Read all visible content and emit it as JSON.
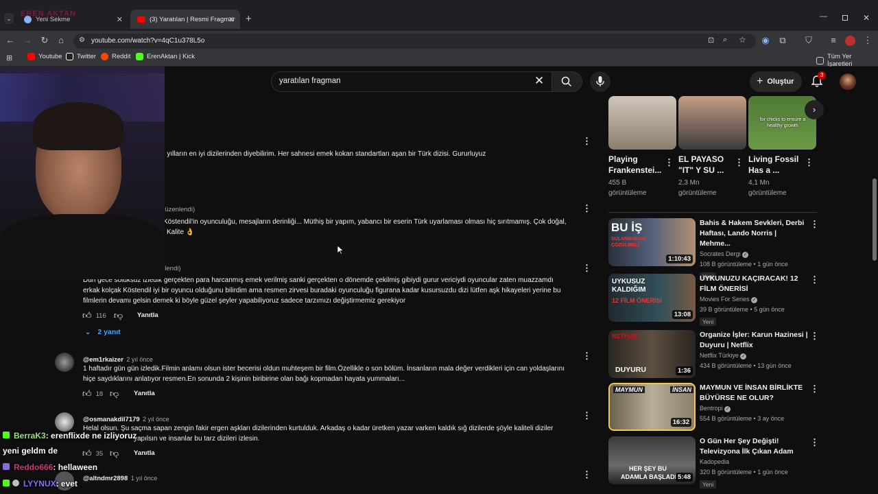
{
  "browser": {
    "tabs": [
      {
        "title": "Yeni Sekme",
        "active": false
      },
      {
        "title": "(3) Yaratılan | Resmi Fragman | N",
        "active": true
      }
    ],
    "url": "youtube.com/watch?v=4qC1u378L5o",
    "bookmarks": [
      {
        "label": "Youtube",
        "color": "#ff0000"
      },
      {
        "label": "Twitter",
        "color": "#ffffff"
      },
      {
        "label": "Reddit",
        "color": "#ff4500"
      },
      {
        "label": "ErenAktan | Kick",
        "color": "#53fc18"
      }
    ],
    "all_bookmarks_label": "Tüm Yer İşaretleri",
    "stream_tag": "EREN AKTAN"
  },
  "youtube": {
    "search_query": "yaratılan fragman",
    "create_label": "Oluştur",
    "notification_count": "3",
    "comments": [
      {
        "text": "n yılların en iyi dizilerinden diyebilirim. Her sahnesi emek kokan standartları aşan bir Türk dizisi. Gururluyuz"
      },
      {
        "meta": "düzenlendi)",
        "text_line1": "Köstendil'in oyunculuğu, mesajların derinliği... Müthiş bir yapım, yabancı bir eserin Türk uyarlaması olması hiç sırıtmamış. Çok doğal,",
        "text_line2": "Kalite 👌"
      },
      {
        "meta": "nlendi)",
        "text_line1": "Dün gece soluksuz izledik gerçekten para harcanmış emek verilmiş sanki gerçekten o dönemde çekilmiş gibiydi gurur vericiydi oyuncular zaten muazzamdı",
        "text_line2": "erkak kolçak Köstendil iyi bir oyuncu olduğunu bilirdim ama resmen zirvesi buradaki oyunculuğu figurana kadar kusursuzdu dizi lütfen aşk hikayeleri yerine bu",
        "text_line3": "filmlerin devamı gelsin demek ki böyle güzel şeyler yapabiliyoruz sadece tarzımızı değiştirmemiz gerekiyor",
        "likes": "116",
        "reply": "Yanıtla",
        "replies": "2 yanıt"
      },
      {
        "author": "@em1rkaizer",
        "time": "2 yıl önce",
        "text_line1": "1 haftadır gün gün izledik.Filmin anlamı olsun ister becerisi oldun muhteşem bir film.Özellikle o son bölüm. İnsanların mala değer verdikleri için can yoldaşlarını",
        "text_line2": "hiçe saydıklarını anlatıyor resmen.En sonunda 2 kişinin biribirine olan bağı kopmadan hayata yummaları...",
        "likes": "18",
        "reply": "Yanıtla"
      },
      {
        "author": "@osmanakdil7179",
        "time": "2 yıl önce",
        "text_line1": "Helal olsun. Şu saçma sapan zengin fakir ergen aşkları dizilerinden kurtulduk.  Arkadaş o kadar üretken yazar varken kaldık sığ dizilerde şöyle kaliteli diziler",
        "text_line2": "yapılsın ve insanlar bu tarz dizileri izlesin.",
        "likes": "35",
        "reply": "Yanıtla"
      },
      {
        "author": "@altndmr2898",
        "time": "1 yıl önce"
      }
    ],
    "shorts": [
      {
        "title1": "Playing",
        "title2": "Frankenstei...",
        "views1": "455 B",
        "views2": "görüntüleme"
      },
      {
        "title1": "EL PAYASO",
        "title2": "\"IT\" Y SU ...",
        "views1": "2,3 Mn",
        "views2": "görüntüleme"
      },
      {
        "title1": "Living Fossil",
        "title2": "Has a ...",
        "views1": "4,1 Mn",
        "views2": "görüntüleme",
        "caption": "for chicks to ensure a healthy growth"
      }
    ],
    "related": [
      {
        "title1": "Bahis & Hakem Sevkleri, Derbi",
        "title2": "Haftası, Lando Norris | Mehme...",
        "channel": "Socrates Dergi",
        "meta": "108 B görüntüleme • 1 gün önce",
        "badge": "Yeni",
        "duration": "1:10:43",
        "thumb_text": "BU İŞ",
        "thumb_text2": "SULANMADAN ÇÖZÜLMELİ"
      },
      {
        "title1": "UYKUNUZU KAÇIRACAK! 12",
        "title2": "FİLM ÖNERİSİ",
        "channel": "Movies For Series",
        "meta": "39 B görüntüleme • 5 gün önce",
        "badge": "Yeni",
        "duration": "13:08",
        "thumb_text": "UYKUSUZ KALDIĞIM",
        "thumb_text2": "12 FİLM ÖNERİSİ"
      },
      {
        "title1": "Organize İşler: Karun Hazinesi |",
        "title2": "Duyuru | Netflix",
        "channel": "Netflix Türkiye",
        "meta": "434 B görüntüleme • 13 gün önce",
        "duration": "1:36",
        "thumb_text": "NETFLIX",
        "thumb_text2": "DUYURU"
      },
      {
        "title1": "MAYMUN VE İNSAN BİRLİKTE",
        "title2": "BÜYÜRSE NE OLUR?",
        "channel": "Bentropi",
        "meta": "554 B görüntüleme • 3 ay önce",
        "duration": "16:32",
        "thumb_text": "MAYMUN",
        "thumb_text2": "İNSAN"
      },
      {
        "title1": "O Gün Her Şey Değişti!",
        "title2": "Televizyona İlk Çıkan Adam",
        "channel": "Kadopedia",
        "meta": "320 B görüntüleme • 1 gün önce",
        "badge": "Yeni",
        "duration": "5:48",
        "thumb_text": "HER ŞEY BU",
        "thumb_text2": "ADAMLA BAŞLADI"
      }
    ]
  },
  "chat": [
    {
      "user": "BerraK3",
      "user_color": "#9be37a",
      "message": ": erenflixde ne izliyoruz"
    },
    {
      "user": "",
      "user_color": "#ffffff",
      "message": "yeni geldm de"
    },
    {
      "user": "Reddo666",
      "user_color": "#c7387a",
      "message": ": hellaween"
    },
    {
      "user": "LYYNUX",
      "user_color": "#8f6cff",
      "message": ": evet"
    }
  ]
}
